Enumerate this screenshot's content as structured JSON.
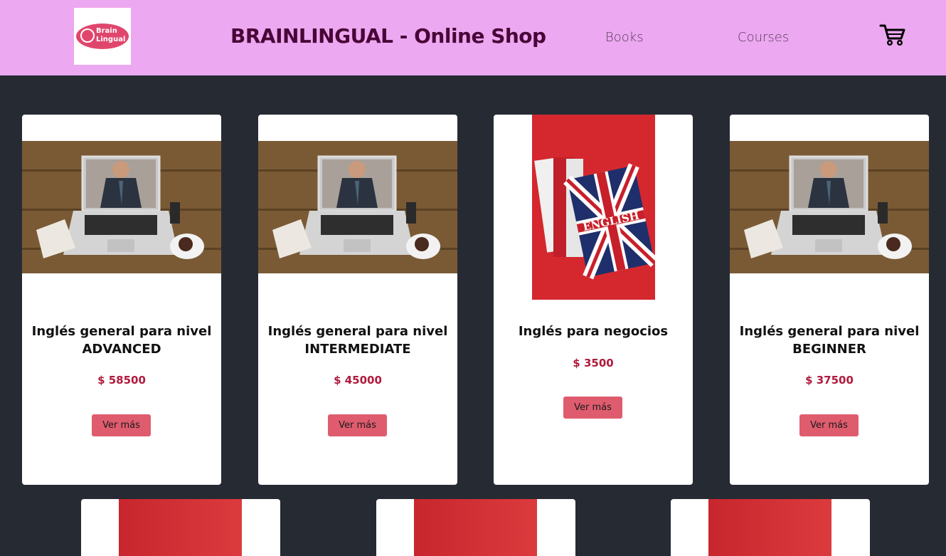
{
  "header": {
    "logo_text": "Brain Lingual",
    "title": "BRAINLINGUAL - Online Shop",
    "nav": [
      {
        "label": "Books"
      },
      {
        "label": "Courses"
      }
    ],
    "cart_icon": "shopping-cart-icon"
  },
  "colors": {
    "header_bg": "#eca8f0",
    "page_bg": "#262a33",
    "title": "#4a0537",
    "price": "#b01a3c",
    "button": "#df5c6e"
  },
  "products": [
    {
      "title": "Inglés general para nivel ADVANCED",
      "price": "$ 58500",
      "button": "Ver más",
      "image": "laptop-video-call-image"
    },
    {
      "title": "Inglés general para nivel INTERMEDIATE",
      "price": "$ 45000",
      "button": "Ver más",
      "image": "laptop-video-call-image"
    },
    {
      "title": "Inglés para negocios",
      "price": "$ 3500",
      "button": "Ver más",
      "image": "english-books-image"
    },
    {
      "title": "Inglés general para nivel BEGINNER",
      "price": "$ 37500",
      "button": "Ver más",
      "image": "laptop-video-call-image"
    }
  ],
  "book_cover_text": "ENGLISH"
}
